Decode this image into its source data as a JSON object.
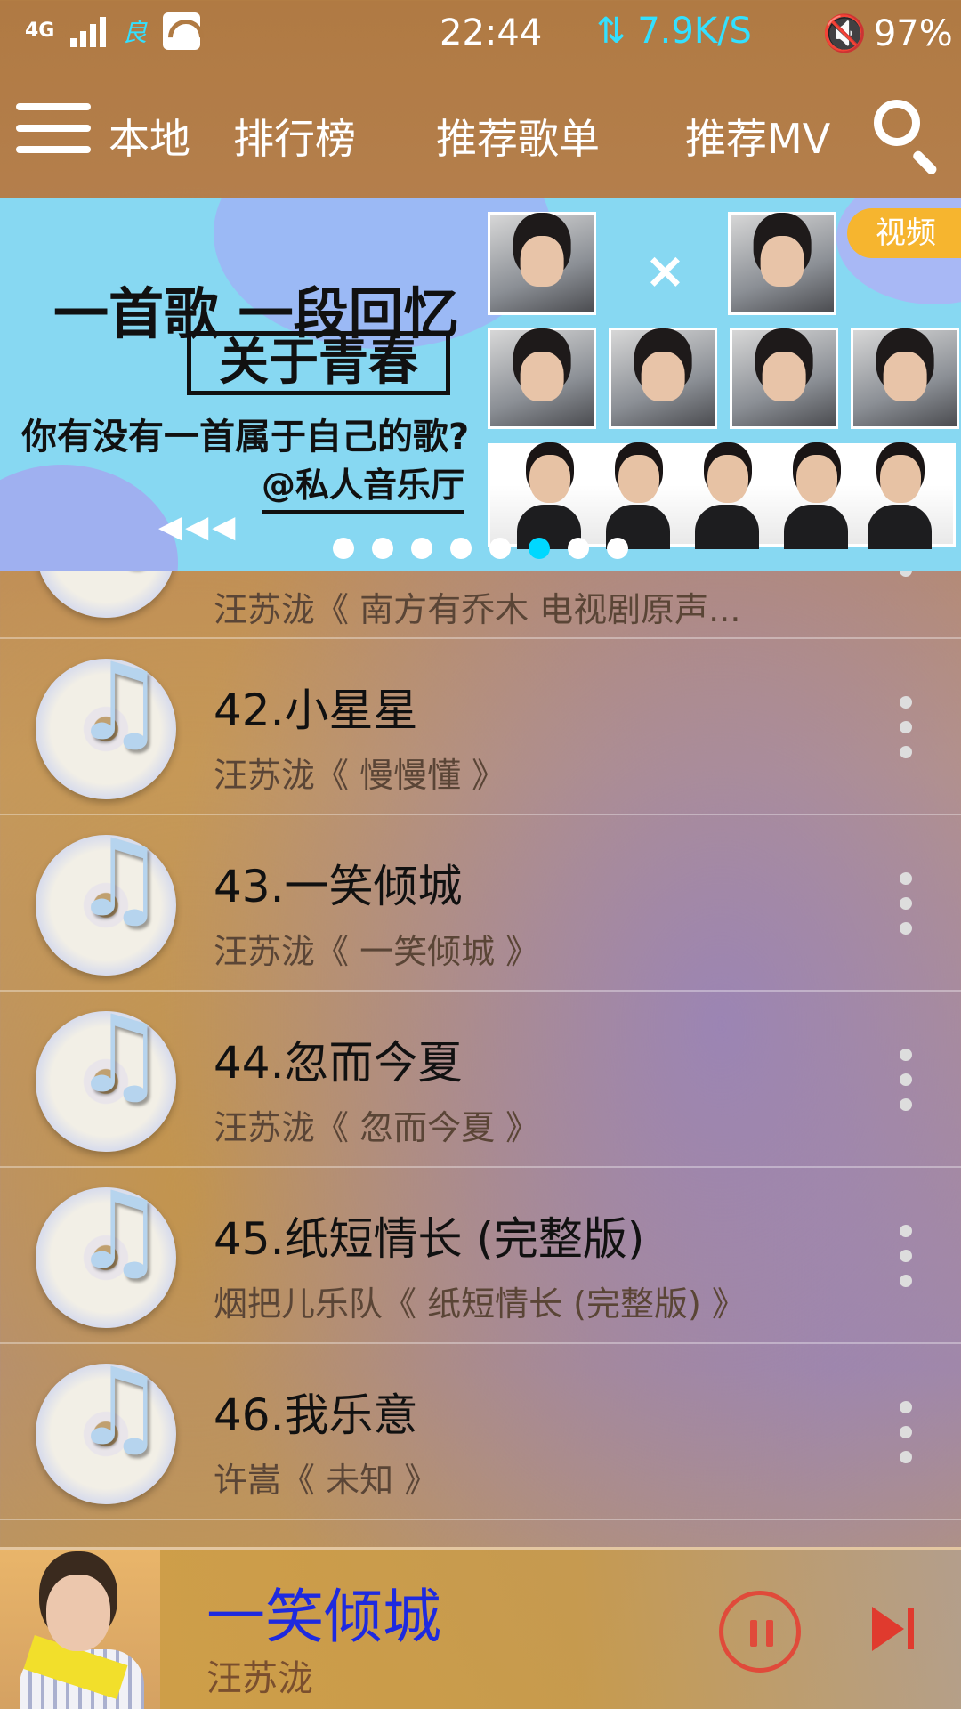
{
  "status_bar": {
    "network": "4G",
    "hd": "良",
    "time": "22:44",
    "speed": "⇅ 7.9K/S",
    "mute_icon": "🔇",
    "battery": "97%"
  },
  "nav": {
    "tabs": [
      {
        "label": "本地"
      },
      {
        "label": "排行榜"
      },
      {
        "label": "推荐歌单"
      },
      {
        "label": "推荐MV"
      }
    ]
  },
  "banner": {
    "title": "一首歌  一段回忆",
    "boxed": "关于青春",
    "subtitle": "你有没有一首属于自己的歌?",
    "credit": "@私人音乐厅",
    "arrows": "◀◀◀",
    "cross": "×",
    "badge": "视频",
    "page_count": 8,
    "active_page": 6
  },
  "songs": [
    {
      "title": "",
      "artist": "汪苏泷《 南方有乔木 电视剧原声..."
    },
    {
      "title": "42.小星星",
      "artist": "汪苏泷《 慢慢懂 》"
    },
    {
      "title": "43.一笑倾城",
      "artist": "汪苏泷《 一笑倾城 》"
    },
    {
      "title": "44.忽而今夏",
      "artist": "汪苏泷《 忽而今夏 》"
    },
    {
      "title": "45.纸短情长 (完整版)",
      "artist": "烟把儿乐队《 纸短情长 (完整版) 》"
    },
    {
      "title": "46.我乐意",
      "artist": "许嵩《 未知 》"
    }
  ],
  "player": {
    "title": "一笑倾城",
    "artist": "汪苏泷"
  },
  "colors": {
    "accent_cyan": "#00d8ff",
    "now_playing_title": "#1e2adf",
    "control_red": "#e04a3a",
    "badge_orange": "#f6b52f"
  }
}
